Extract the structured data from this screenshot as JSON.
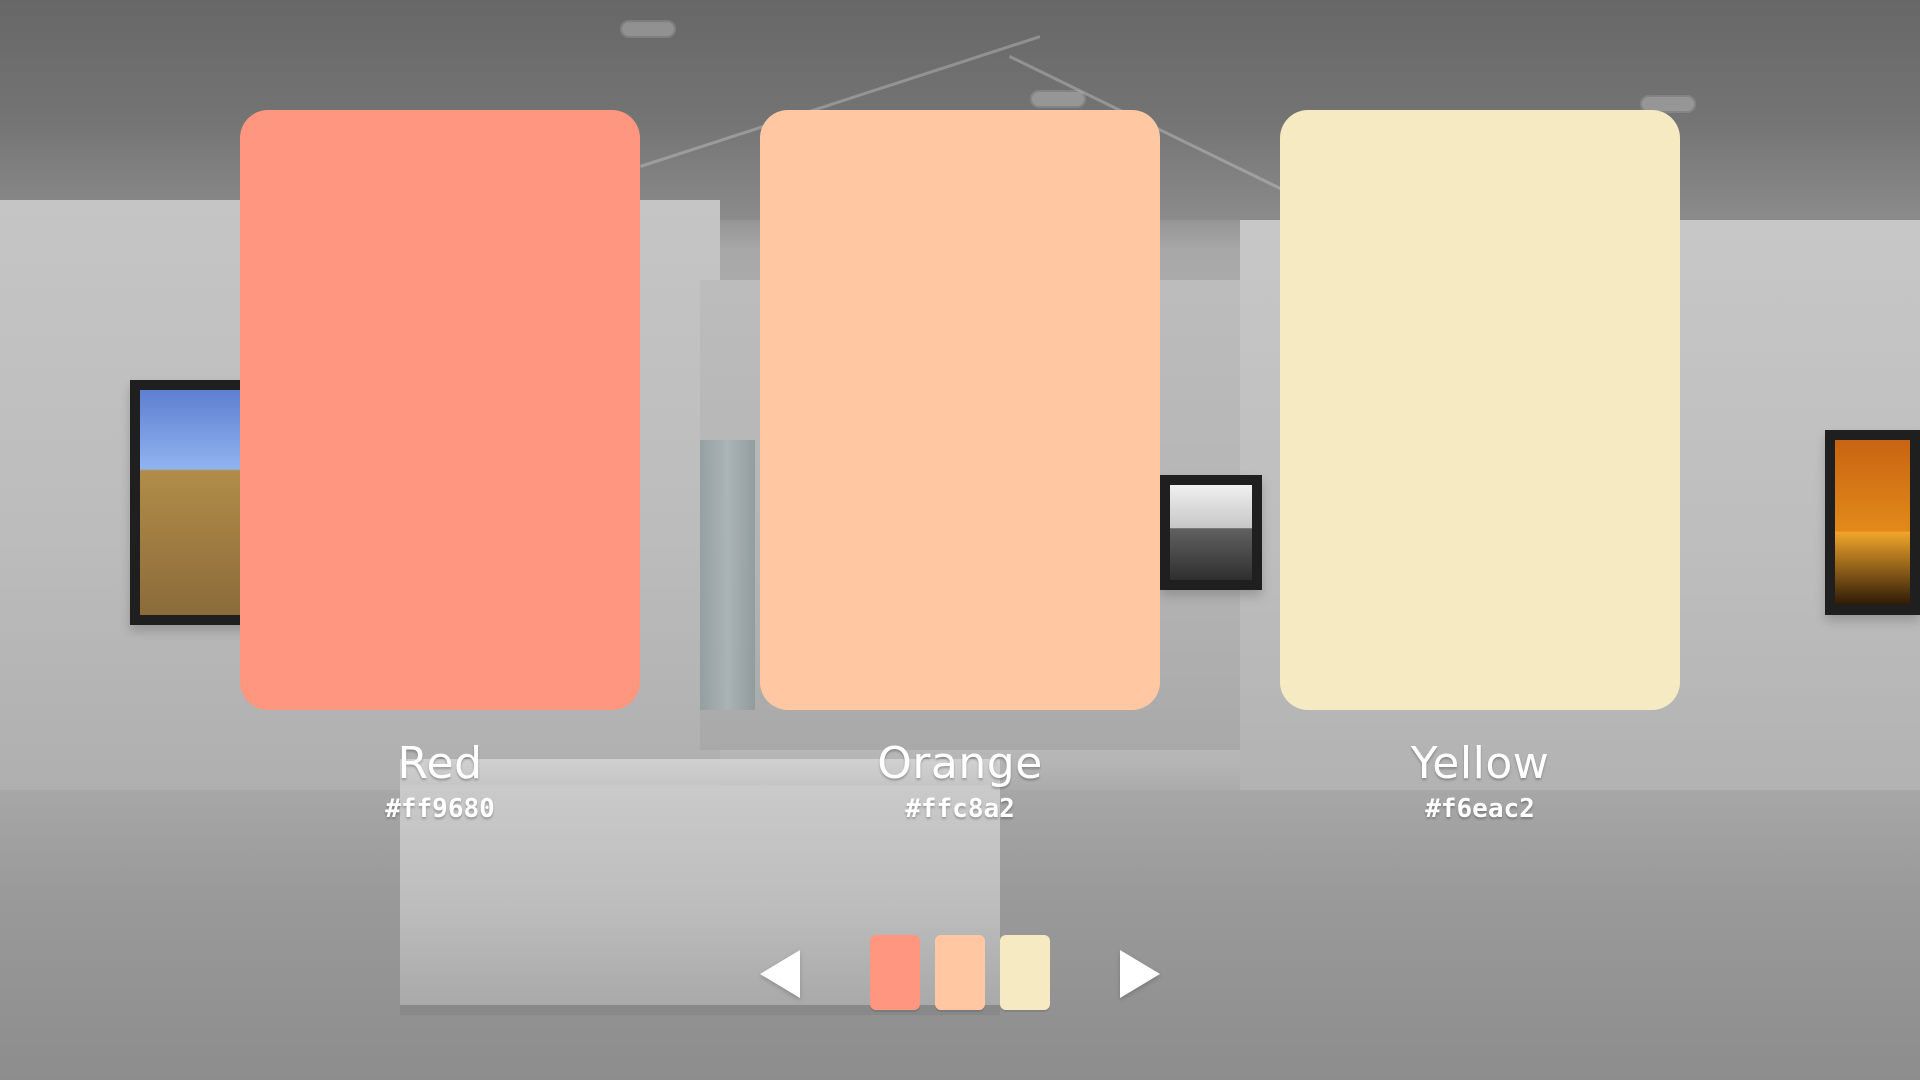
{
  "colors": {
    "primary": [
      {
        "name": "Red",
        "hex": "#ff9680"
      },
      {
        "name": "Orange",
        "hex": "#ffc8a2"
      },
      {
        "name": "Yellow",
        "hex": "#f6eac2"
      }
    ],
    "ui": {
      "text": "#ffffff"
    }
  },
  "icons": {
    "prev": "left-triangle-icon",
    "next": "right-triangle-icon"
  }
}
